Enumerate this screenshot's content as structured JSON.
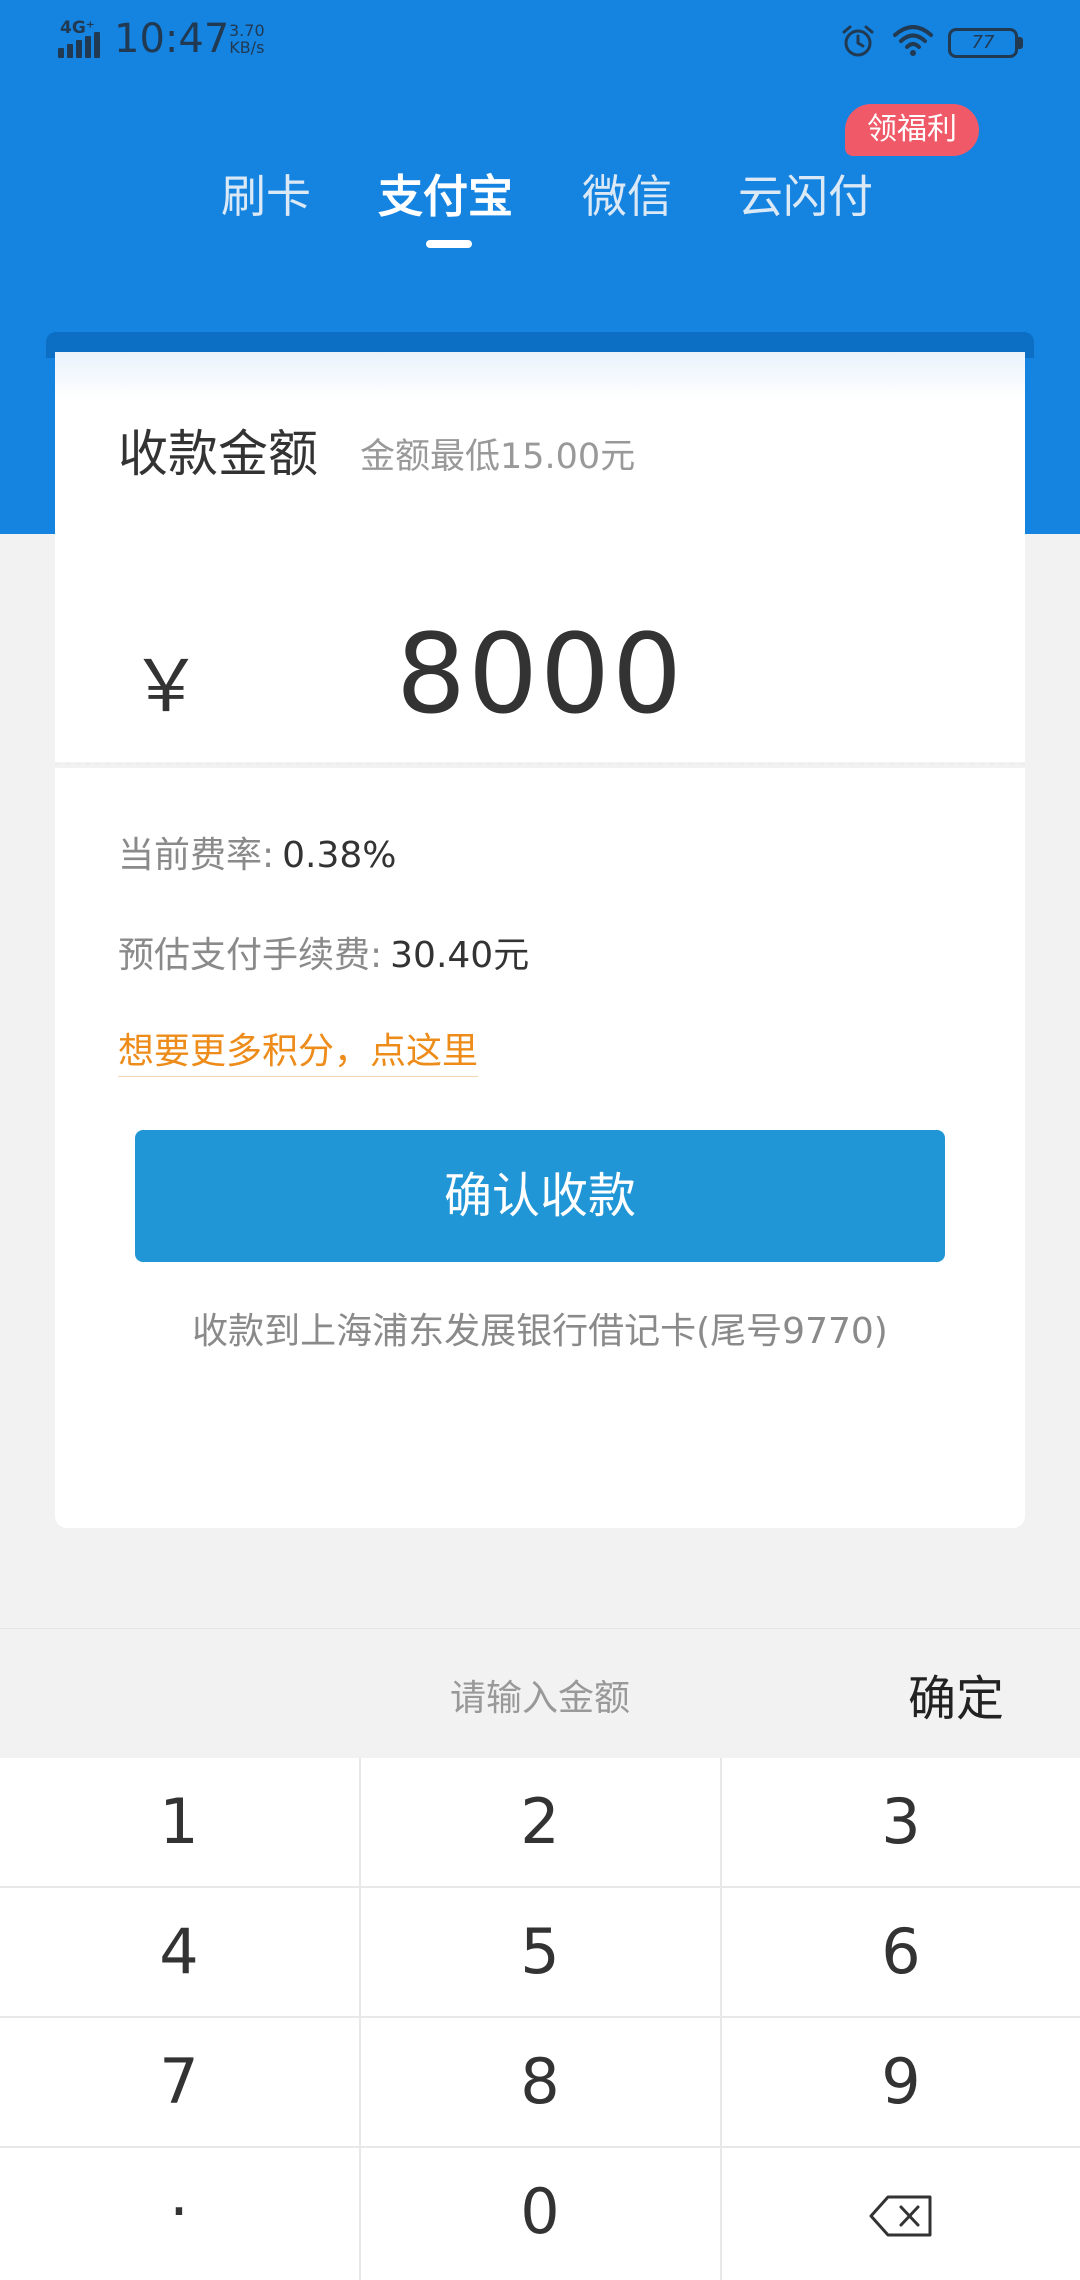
{
  "status_bar": {
    "network": "4G⁺",
    "time": "10:47",
    "net_speed_value": "3.70",
    "net_speed_unit": "KB/s",
    "battery": "77"
  },
  "tabs": [
    {
      "label": "刷卡"
    },
    {
      "label": "支付宝"
    },
    {
      "label": "微信"
    },
    {
      "label": "云闪付"
    }
  ],
  "active_tab": 1,
  "promo_badge": "领福利",
  "payment": {
    "title": "收款金额",
    "min_hint": "金额最低15.00元",
    "currency_symbol": "￥",
    "amount": "8000",
    "rate_label": "当前费率:",
    "rate_value": "0.38%",
    "fee_label": "预估支付手续费:",
    "fee_value": "30.40元",
    "points_link": "想要更多积分，点这里",
    "confirm_button": "确认收款",
    "account_info": "收款到上海浦东发展银行借记卡(尾号9770)"
  },
  "keyboard": {
    "placeholder": "请输入金额",
    "done": "确定",
    "keys": [
      "1",
      "2",
      "3",
      "4",
      "5",
      "6",
      "7",
      "8",
      "9",
      "·",
      "0"
    ]
  },
  "colors": {
    "brand_blue": "#1583e0",
    "button_blue": "#2196d6",
    "link_orange": "#ed8c1a",
    "badge_red": "#f05a68"
  },
  "icons": [
    "signal-icon",
    "alarm-icon",
    "wifi-icon",
    "battery-icon",
    "backspace-icon"
  ]
}
